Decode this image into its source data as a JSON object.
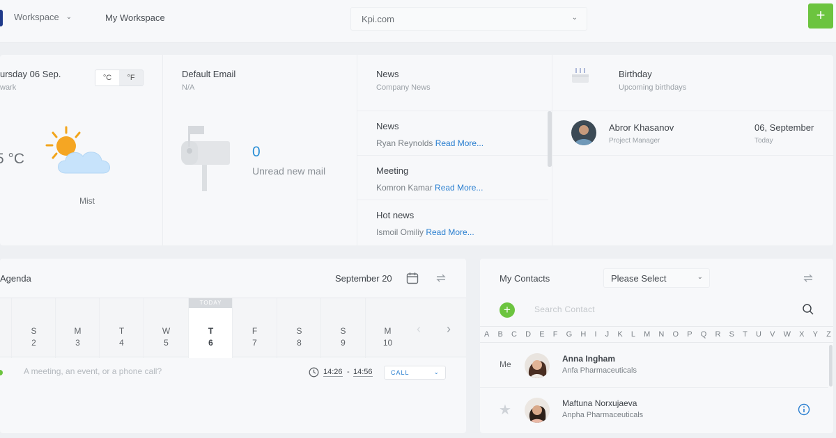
{
  "topbar": {
    "workspace_label": "Workspace",
    "workspace_name": "My Workspace",
    "domain": "Kpi.com",
    "add_label": "+"
  },
  "weather": {
    "date": "ursday 06 Sep.",
    "location": "wark",
    "unit_c": "°C",
    "unit_f": "°F",
    "temperature": "5 °C",
    "condition": "Mist"
  },
  "email": {
    "title": "Default Email",
    "address": "N/A",
    "count": "0",
    "label": "Unread new mail"
  },
  "news": {
    "title": "News",
    "subtitle": "Company News",
    "read_more": "Read More...",
    "items": [
      {
        "title": "News",
        "author": "Ryan Reynolds"
      },
      {
        "title": "Meeting",
        "author": "Komron Kamar"
      },
      {
        "title": "Hot news",
        "author": "Ismoil Omiliy"
      }
    ]
  },
  "birthday": {
    "title": "Birthday",
    "subtitle": "Upcoming birthdays",
    "person": {
      "name": "Abror Khasanov",
      "role": "Project Manager",
      "date": "06, September",
      "when": "Today"
    }
  },
  "agenda": {
    "title": "Agenda",
    "month": "September 20",
    "today_tag": "TODAY",
    "days": [
      {
        "name": "S",
        "num": "2"
      },
      {
        "name": "M",
        "num": "3"
      },
      {
        "name": "T",
        "num": "4"
      },
      {
        "name": "W",
        "num": "5"
      },
      {
        "name": "T",
        "num": "6"
      },
      {
        "name": "F",
        "num": "7"
      },
      {
        "name": "S",
        "num": "8"
      },
      {
        "name": "S",
        "num": "9"
      },
      {
        "name": "M",
        "num": "10"
      }
    ],
    "placeholder": "A meeting, an event, or a phone call?",
    "time_from": "14:26",
    "time_sep": "-",
    "time_to": "14:56",
    "type": "CALL"
  },
  "contacts": {
    "title": "My Contacts",
    "filter": "Please Select",
    "search_placeholder": "Search Contact",
    "alphabet": [
      "A",
      "B",
      "C",
      "D",
      "E",
      "F",
      "G",
      "H",
      "I",
      "J",
      "K",
      "L",
      "M",
      "N",
      "O",
      "P",
      "Q",
      "R",
      "S",
      "T",
      "U",
      "V",
      "W",
      "X",
      "Y",
      "Z"
    ],
    "me_label": "Me",
    "list": [
      {
        "name": "Anna Ingham",
        "company": "Anfa Pharmaceuticals"
      },
      {
        "name": "Maftuna Norxujaeva",
        "company": "Anpha Pharmaceuticals"
      }
    ]
  },
  "colors": {
    "accent_green": "#6cc43f",
    "link_blue": "#2a7fd0",
    "background": "#eef0f3",
    "panel": "#f7f8fa"
  }
}
